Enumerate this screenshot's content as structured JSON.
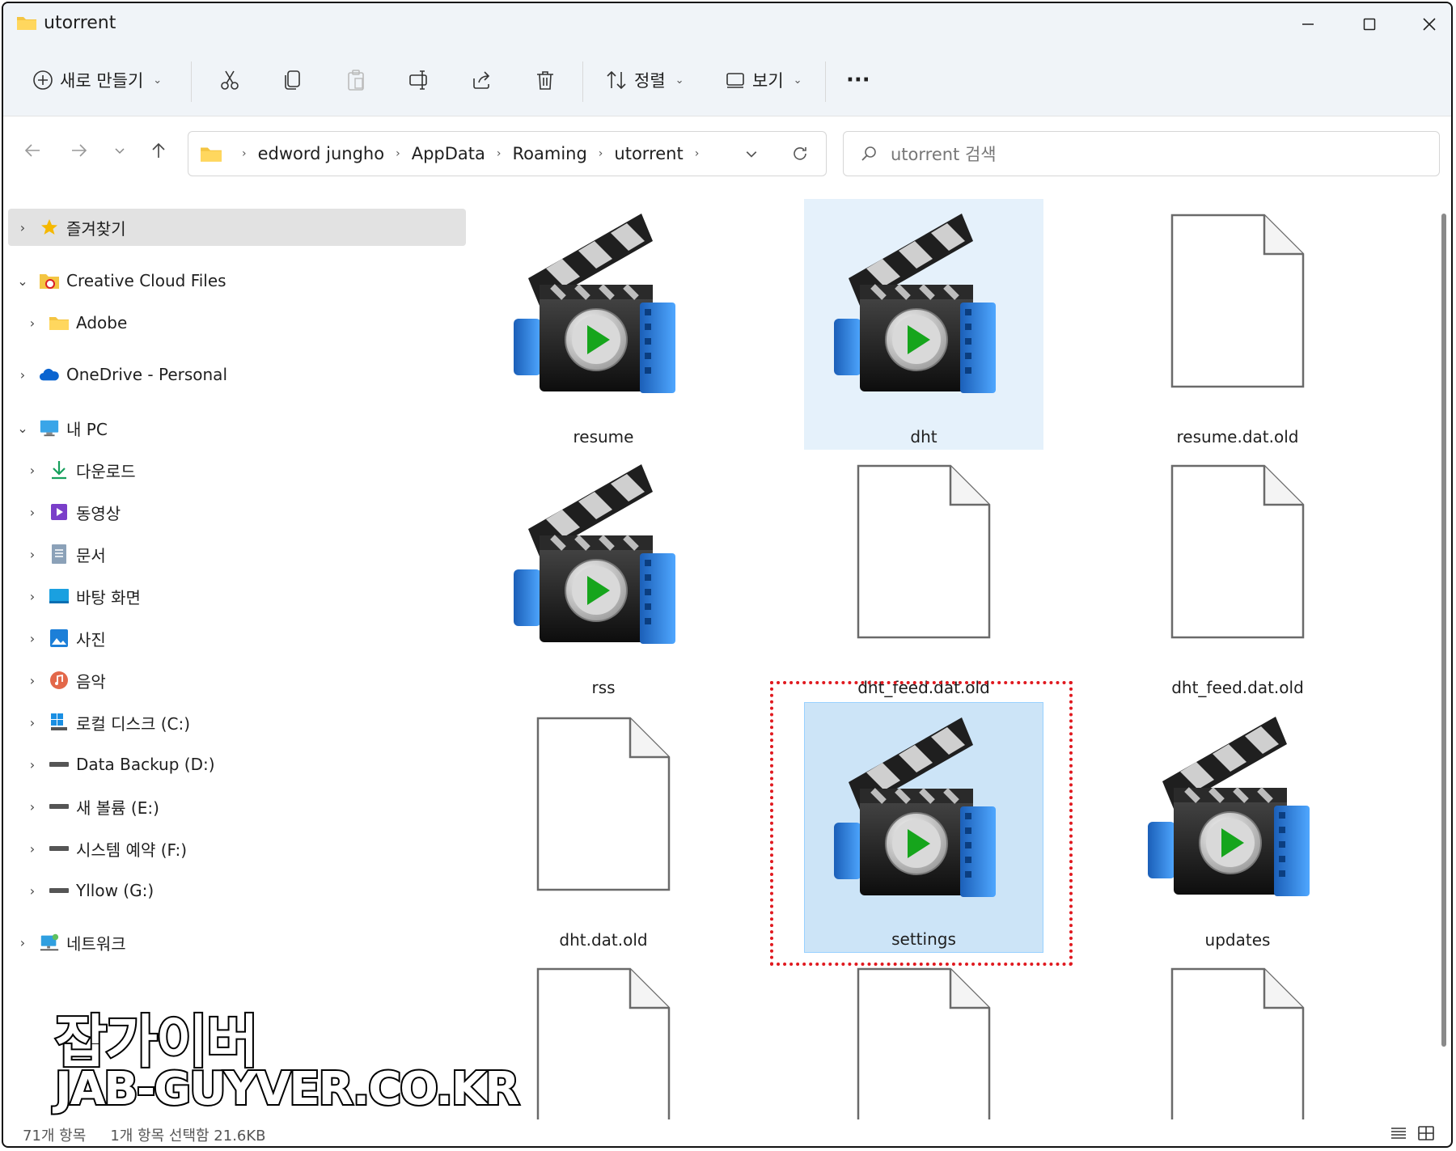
{
  "window": {
    "title": "utorrent"
  },
  "toolbar": {
    "new_label": "새로 만들기",
    "sort_label": "정렬",
    "view_label": "보기",
    "more_label": "···"
  },
  "address": {
    "crumbs": [
      "edword jungho",
      "AppData",
      "Roaming",
      "utorrent"
    ]
  },
  "search": {
    "placeholder": "utorrent 검색"
  },
  "sidebar": {
    "items": [
      {
        "label": "즐겨찾기",
        "icon": "star-icon"
      },
      {
        "label": "Creative Cloud Files",
        "icon": "creative-cloud-folder-icon"
      },
      {
        "label": "Adobe",
        "icon": "folder-icon"
      },
      {
        "label": "OneDrive - Personal",
        "icon": "onedrive-cloud-icon"
      },
      {
        "label": "내 PC",
        "icon": "monitor-icon"
      },
      {
        "label": "다운로드",
        "icon": "download-icon"
      },
      {
        "label": "동영상",
        "icon": "video-icon"
      },
      {
        "label": "문서",
        "icon": "document-icon"
      },
      {
        "label": "바탕 화면",
        "icon": "desktop-icon"
      },
      {
        "label": "사진",
        "icon": "pictures-icon"
      },
      {
        "label": "음악",
        "icon": "music-icon"
      },
      {
        "label": "로컬 디스크 (C:)",
        "icon": "drive-c-icon"
      },
      {
        "label": "Data Backup (D:)",
        "icon": "drive-icon"
      },
      {
        "label": "새 볼륨 (E:)",
        "icon": "drive-icon"
      },
      {
        "label": "시스템 예약 (F:)",
        "icon": "drive-icon"
      },
      {
        "label": "Yllow (G:)",
        "icon": "drive-icon"
      },
      {
        "label": "네트워크",
        "icon": "network-icon"
      }
    ]
  },
  "files": [
    {
      "name": "resume",
      "type": "media"
    },
    {
      "name": "dht",
      "type": "media"
    },
    {
      "name": "resume.dat.old",
      "type": "blank"
    },
    {
      "name": "rss",
      "type": "media"
    },
    {
      "name": "dht_feed.dat.old",
      "type": "blank"
    },
    {
      "name": "dht_feed.dat.old",
      "type": "blank"
    },
    {
      "name": "dht.dat.old",
      "type": "blank"
    },
    {
      "name": "settings",
      "type": "media"
    },
    {
      "name": "updates",
      "type": "media"
    },
    {
      "name": "",
      "type": "blank"
    },
    {
      "name": "",
      "type": "blank"
    },
    {
      "name": "",
      "type": "blank"
    }
  ],
  "status": {
    "count": "71개 항목",
    "selection": "1개 항목 선택함 21.6KB"
  },
  "watermark": {
    "line1": "잡가이버",
    "line2": "JAB-GUYVER.CO.KR"
  },
  "colors": {
    "accent": "#0067c0",
    "highlight_border": "#e0191f",
    "selection": "#cce4f7"
  }
}
